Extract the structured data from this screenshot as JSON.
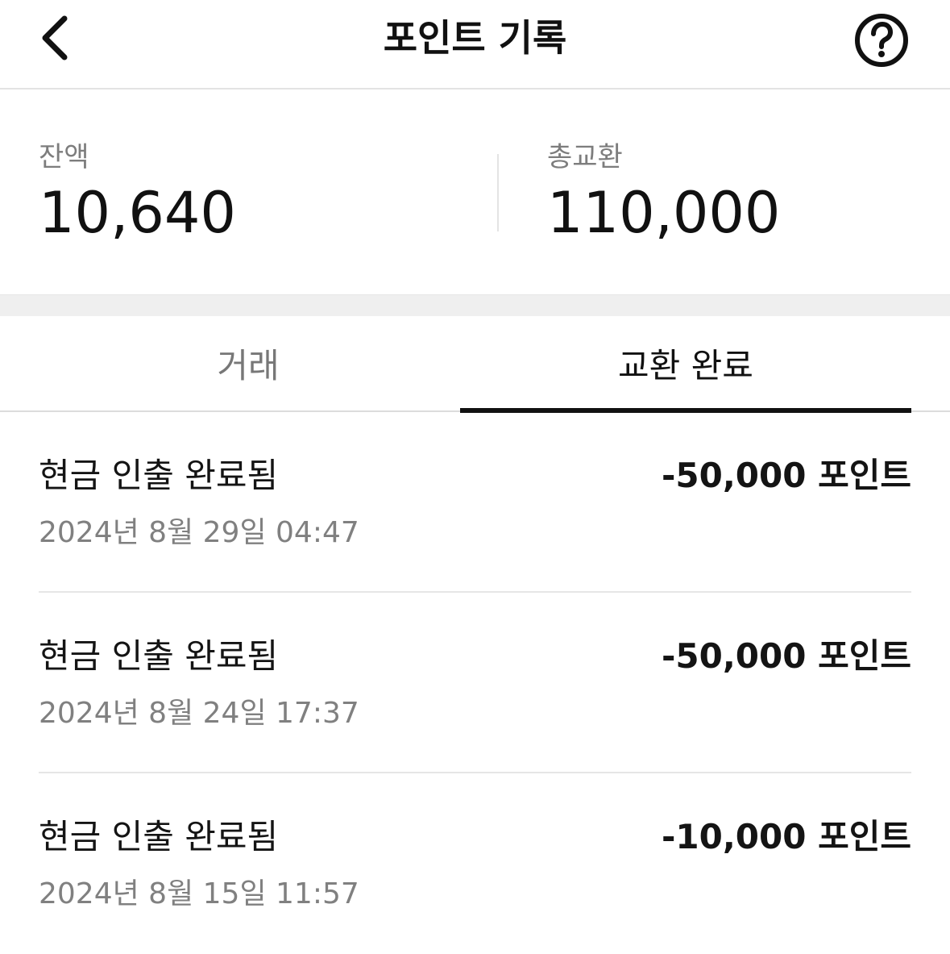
{
  "header": {
    "title": "포인트 기록",
    "back_icon": "chevron-left-icon",
    "help_icon": "question-circle-icon"
  },
  "summary": {
    "balance_label": "잔액",
    "balance_value": "10,640",
    "total_exchange_label": "총교환",
    "total_exchange_value": "110,000"
  },
  "tabs": [
    {
      "label": "거래",
      "active": false
    },
    {
      "label": "교환 완료",
      "active": true
    }
  ],
  "records": [
    {
      "title": "현금 인출 완료됨",
      "amount": "-50,000 포인트",
      "date": "2024년 8월 29일 04:47"
    },
    {
      "title": "현금 인출 완료됨",
      "amount": "-50,000 포인트",
      "date": "2024년 8월 24일 17:37"
    },
    {
      "title": "현금 인출 완료됨",
      "amount": "-10,000 포인트",
      "date": "2024년 8월 15일 11:57"
    }
  ],
  "colors": {
    "text_primary": "#111111",
    "text_secondary": "#808080",
    "tab_active_underline": "#111111",
    "divider": "#e6e6e6",
    "band": "#efefef"
  }
}
